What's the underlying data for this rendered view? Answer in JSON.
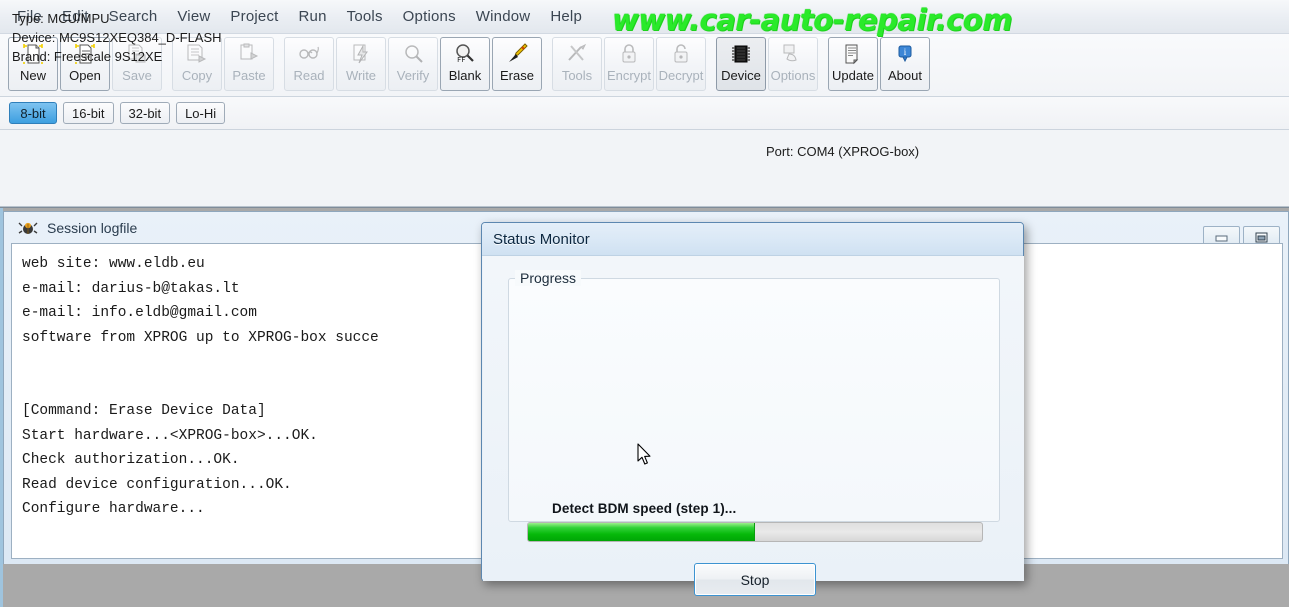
{
  "app": {
    "watermark": "www.car-auto-repair.com"
  },
  "menubar": {
    "items": [
      {
        "label": "File"
      },
      {
        "label": "Edit"
      },
      {
        "label": "Search"
      },
      {
        "label": "View"
      },
      {
        "label": "Project"
      },
      {
        "label": "Run"
      },
      {
        "label": "Tools"
      },
      {
        "label": "Options"
      },
      {
        "label": "Window"
      },
      {
        "label": "Help"
      }
    ]
  },
  "toolbar": {
    "buttons": [
      {
        "label": "New",
        "icon": "new-file-icon",
        "state": "enabled"
      },
      {
        "label": "Open",
        "icon": "open-folder-icon",
        "state": "enabled"
      },
      {
        "label": "Save",
        "icon": "save-disk-icon",
        "state": "disabled"
      },
      {
        "label": "Copy",
        "icon": "copy-icon",
        "state": "disabled"
      },
      {
        "label": "Paste",
        "icon": "paste-icon",
        "state": "disabled"
      },
      {
        "label": "Read",
        "icon": "read-glasses-icon",
        "state": "disabled"
      },
      {
        "label": "Write",
        "icon": "write-bolt-icon",
        "state": "disabled"
      },
      {
        "label": "Verify",
        "icon": "verify-magnifier-icon",
        "state": "disabled"
      },
      {
        "label": "Blank",
        "icon": "blank-check-icon",
        "state": "enabled"
      },
      {
        "label": "Erase",
        "icon": "erase-pencil-icon",
        "state": "enabled"
      },
      {
        "label": "Tools",
        "icon": "tools-icon",
        "state": "disabled"
      },
      {
        "label": "Encrypt",
        "icon": "lock-closed-icon",
        "state": "disabled"
      },
      {
        "label": "Decrypt",
        "icon": "lock-open-icon",
        "state": "disabled"
      },
      {
        "label": "Device",
        "icon": "chip-icon",
        "state": "active"
      },
      {
        "label": "Options",
        "icon": "options-icon",
        "state": "disabled"
      },
      {
        "label": "Update",
        "icon": "update-doc-icon",
        "state": "enabled"
      },
      {
        "label": "About",
        "icon": "about-info-icon",
        "state": "enabled"
      }
    ]
  },
  "bitbar": {
    "buttons": [
      {
        "label": "8-bit",
        "selected": true
      },
      {
        "label": "16-bit",
        "selected": false
      },
      {
        "label": "32-bit",
        "selected": false
      },
      {
        "label": "Lo-Hi",
        "selected": false
      }
    ]
  },
  "info": {
    "type_line": "Type: MCU/MPU",
    "device_line": "Device: MC9S12XEQ384_D-FLASH",
    "brand_line": "Brand: Freescale 9S12XE",
    "port_line": "Port: COM4 (XPROG-box)"
  },
  "log_window": {
    "title": "Session logfile",
    "minimize_glyph": "–",
    "restore_glyph": "❐",
    "text": "web site: www.eldb.eu\ne-mail: darius-b@takas.lt\ne-mail: info.eldb@gmail.com\nsoftware from XPROG up to XPROG-box succe\n\n\n[Command: Erase Device Data]\nStart hardware...<XPROG-box>...OK.\nCheck authorization...OK.\nRead device configuration...OK.\nConfigure hardware..."
  },
  "dialog": {
    "title": "Status Monitor",
    "group_label": "Progress",
    "status_text": "Detect BDM speed (step 1)...",
    "progress_percent": 50,
    "stop_label": "Stop",
    "accent_color": "#00a506"
  }
}
